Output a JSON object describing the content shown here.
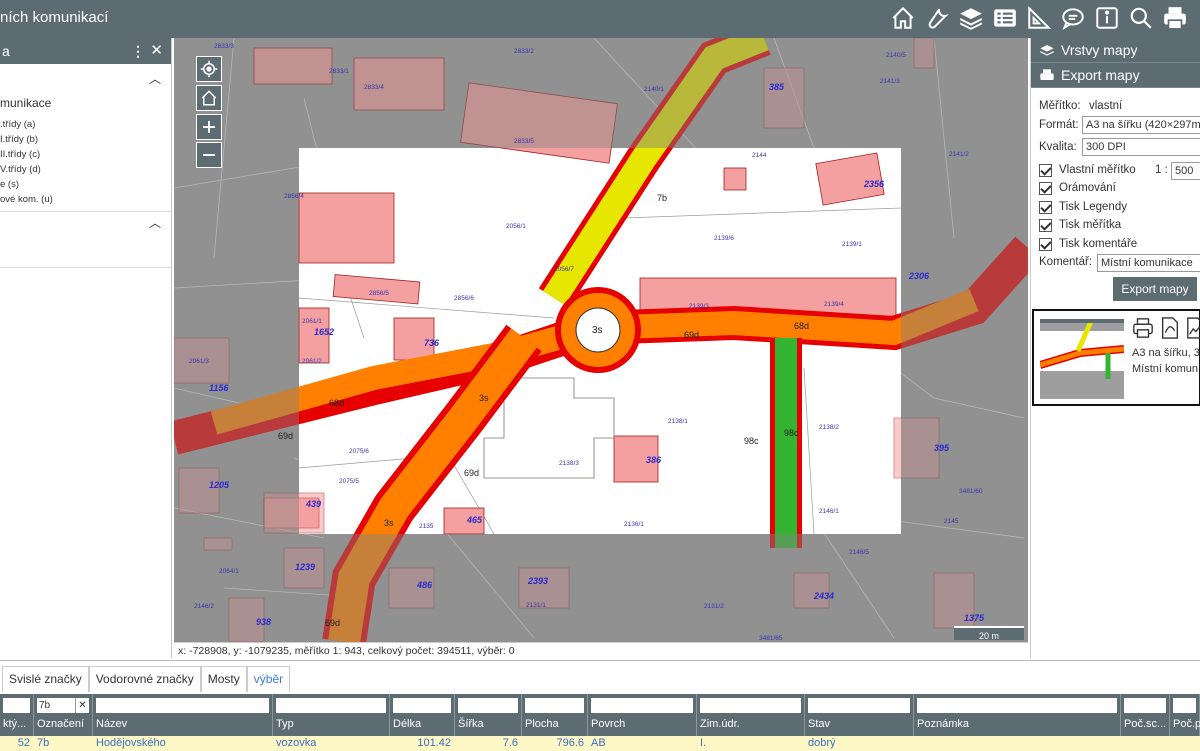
{
  "app": {
    "title": "ních komunikací"
  },
  "toolbar": [
    "home-icon",
    "wrench-icon",
    "layers-icon",
    "list-icon",
    "ruler-icon",
    "comment-icon",
    "info-icon",
    "search-icon",
    "print-icon"
  ],
  "left_panel": {
    "header": "a",
    "title": "munikace",
    "legend": [
      {
        "label": ".třídy (a)",
        "color": "#d40000"
      },
      {
        "label": "I.třídy (b)",
        "color": "#ff8c00"
      },
      {
        "label": "II.třídy (c)",
        "color": "#e8e800"
      },
      {
        "label": "V.třídy (d)",
        "color": "#3cb93c"
      },
      {
        "label": "e (s)",
        "color": "#888888"
      },
      {
        "label": "ové kom. (u)",
        "color": "#aaaaaa"
      }
    ]
  },
  "map": {
    "coord_text": "x: -728908, y: -1079235, měřítko 1: 943, celkový počet: 394511, výběr: 0",
    "scale_label": "20 m",
    "roundabout_label": "3s",
    "road_labels": [
      "7b",
      "68d",
      "69d",
      "68d",
      "69d",
      "3s",
      "3s",
      "69d",
      "69d",
      "98c",
      "98c"
    ],
    "house_numbers": [
      "385",
      "2356",
      "2306",
      "1652",
      "736",
      "1156",
      "395",
      "386",
      "439",
      "1205",
      "465",
      "1239",
      "486",
      "2393",
      "2434",
      "938",
      "1375"
    ],
    "parcels": [
      "2833/3",
      "2833/1",
      "2833/2",
      "2833/4",
      "2833/5",
      "2856/4",
      "2056/1",
      "2056/7",
      "2856/5",
      "2856/6",
      "2139/1",
      "2139/6",
      "2139/3",
      "2139/4",
      "2138/1",
      "2138/3",
      "2138/2",
      "2136/1",
      "2135",
      "2146/1",
      "2146/5",
      "2075/6",
      "2075/5",
      "2061/1",
      "2061/2",
      "2061/3",
      "2064/1",
      "2146/2",
      "2131/2",
      "2131/1",
      "3481/65",
      "3481/60",
      "2145",
      "2144",
      "2140/1",
      "2140/5",
      "2141/3",
      "2141/2"
    ]
  },
  "right_panel": {
    "layers_title": "Vrstvy mapy",
    "export_title": "Export mapy",
    "scale_label": "Měřítko:",
    "scale_value": "vlastní",
    "format_label": "Formát:",
    "format_value": "A3 na šířku (420×297mm)",
    "quality_label": "Kvalita:",
    "quality_value": "300 DPI",
    "own_scale_label": "Vlastní měřítko",
    "own_scale_prefix": "1 :",
    "own_scale_value": "500",
    "checks": [
      "Orámování",
      "Tisk Legendy",
      "Tisk měřítka",
      "Tisk komentáře"
    ],
    "comment_label": "Komentář:",
    "comment_value": "Místní komunikace",
    "export_button": "Export mapy",
    "preview_line1": "A3 na šířku, 3",
    "preview_line2": "Místní komun"
  },
  "bottom": {
    "tabs": [
      "Svislé značky",
      "Vodorovné značky",
      "Mosty",
      "výběr"
    ],
    "columns": [
      {
        "header": "ktý...",
        "filter": ""
      },
      {
        "header": "Označení",
        "filter": "7b"
      },
      {
        "header": "Název",
        "filter": ""
      },
      {
        "header": "Typ",
        "filter": ""
      },
      {
        "header": "Délka",
        "filter": ""
      },
      {
        "header": "Šířka",
        "filter": ""
      },
      {
        "header": "Plocha",
        "filter": ""
      },
      {
        "header": "Povrch",
        "filter": ""
      },
      {
        "header": "Zim.údr.",
        "filter": ""
      },
      {
        "header": "Stav",
        "filter": ""
      },
      {
        "header": "Poznámka",
        "filter": ""
      },
      {
        "header": "Poč.sc...",
        "filter": ""
      },
      {
        "header": "Poč.p...",
        "filter": ""
      }
    ],
    "row": [
      "52",
      "7b",
      "Hodějovského",
      "vozovka",
      "101.42",
      "7.6",
      "796.6",
      "AB",
      "I.",
      "dobrý",
      "",
      "",
      ""
    ]
  },
  "colors": {
    "header": "#5d6b73",
    "map_bg": "#9e9e9e",
    "road_red": "#e60000",
    "road_orange": "#ff8000",
    "road_yellow": "#e6e600",
    "road_green": "#33b533",
    "building": "#f4a0a0"
  }
}
